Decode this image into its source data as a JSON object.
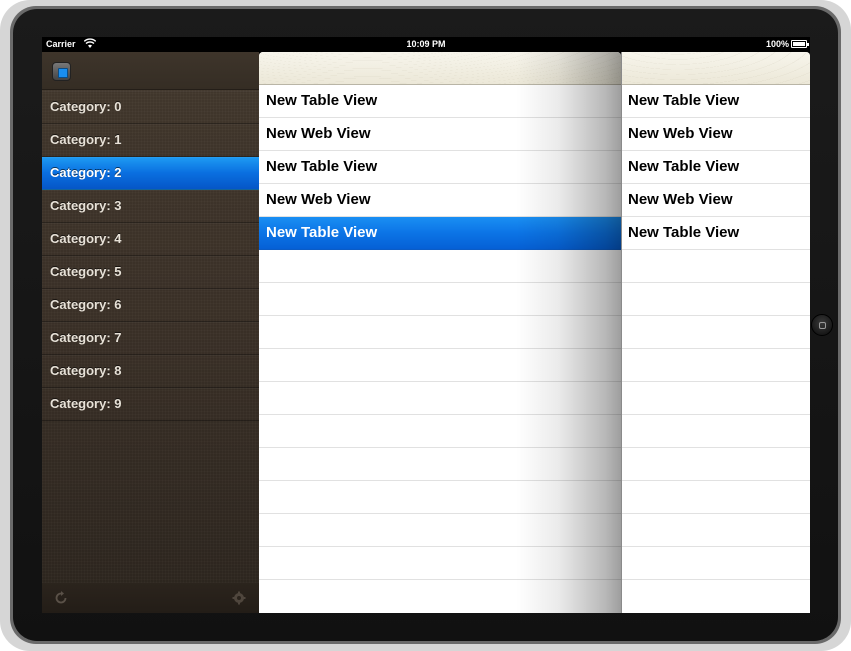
{
  "status_bar": {
    "carrier": "Carrier",
    "time": "10:09 PM",
    "battery": "100%"
  },
  "sidebar": {
    "logo_icon": "app-logo-icon",
    "categories": [
      {
        "label": "Category: 0"
      },
      {
        "label": "Category: 1"
      },
      {
        "label": "Category: 2"
      },
      {
        "label": "Category: 3"
      },
      {
        "label": "Category: 4"
      },
      {
        "label": "Category: 5"
      },
      {
        "label": "Category: 6"
      },
      {
        "label": "Category: 7"
      },
      {
        "label": "Category: 8"
      },
      {
        "label": "Category: 9"
      }
    ],
    "selected_index": 2,
    "footer_icons": [
      "refresh-icon",
      "settings-icon"
    ]
  },
  "panel_1": {
    "rows": [
      {
        "label": "New Table View"
      },
      {
        "label": "New Web View"
      },
      {
        "label": "New Table View"
      },
      {
        "label": "New Web View"
      },
      {
        "label": "New Table View"
      }
    ],
    "selected_index": 4
  },
  "panel_2": {
    "rows": [
      {
        "label": "New Table View"
      },
      {
        "label": "New Web View"
      },
      {
        "label": "New Table View"
      },
      {
        "label": "New Web View"
      },
      {
        "label": "New Table View"
      }
    ]
  },
  "colors": {
    "selection_blue": "#0a6fe0",
    "sidebar_brown": "#3b3128",
    "header_cream": "#f1eee0"
  }
}
